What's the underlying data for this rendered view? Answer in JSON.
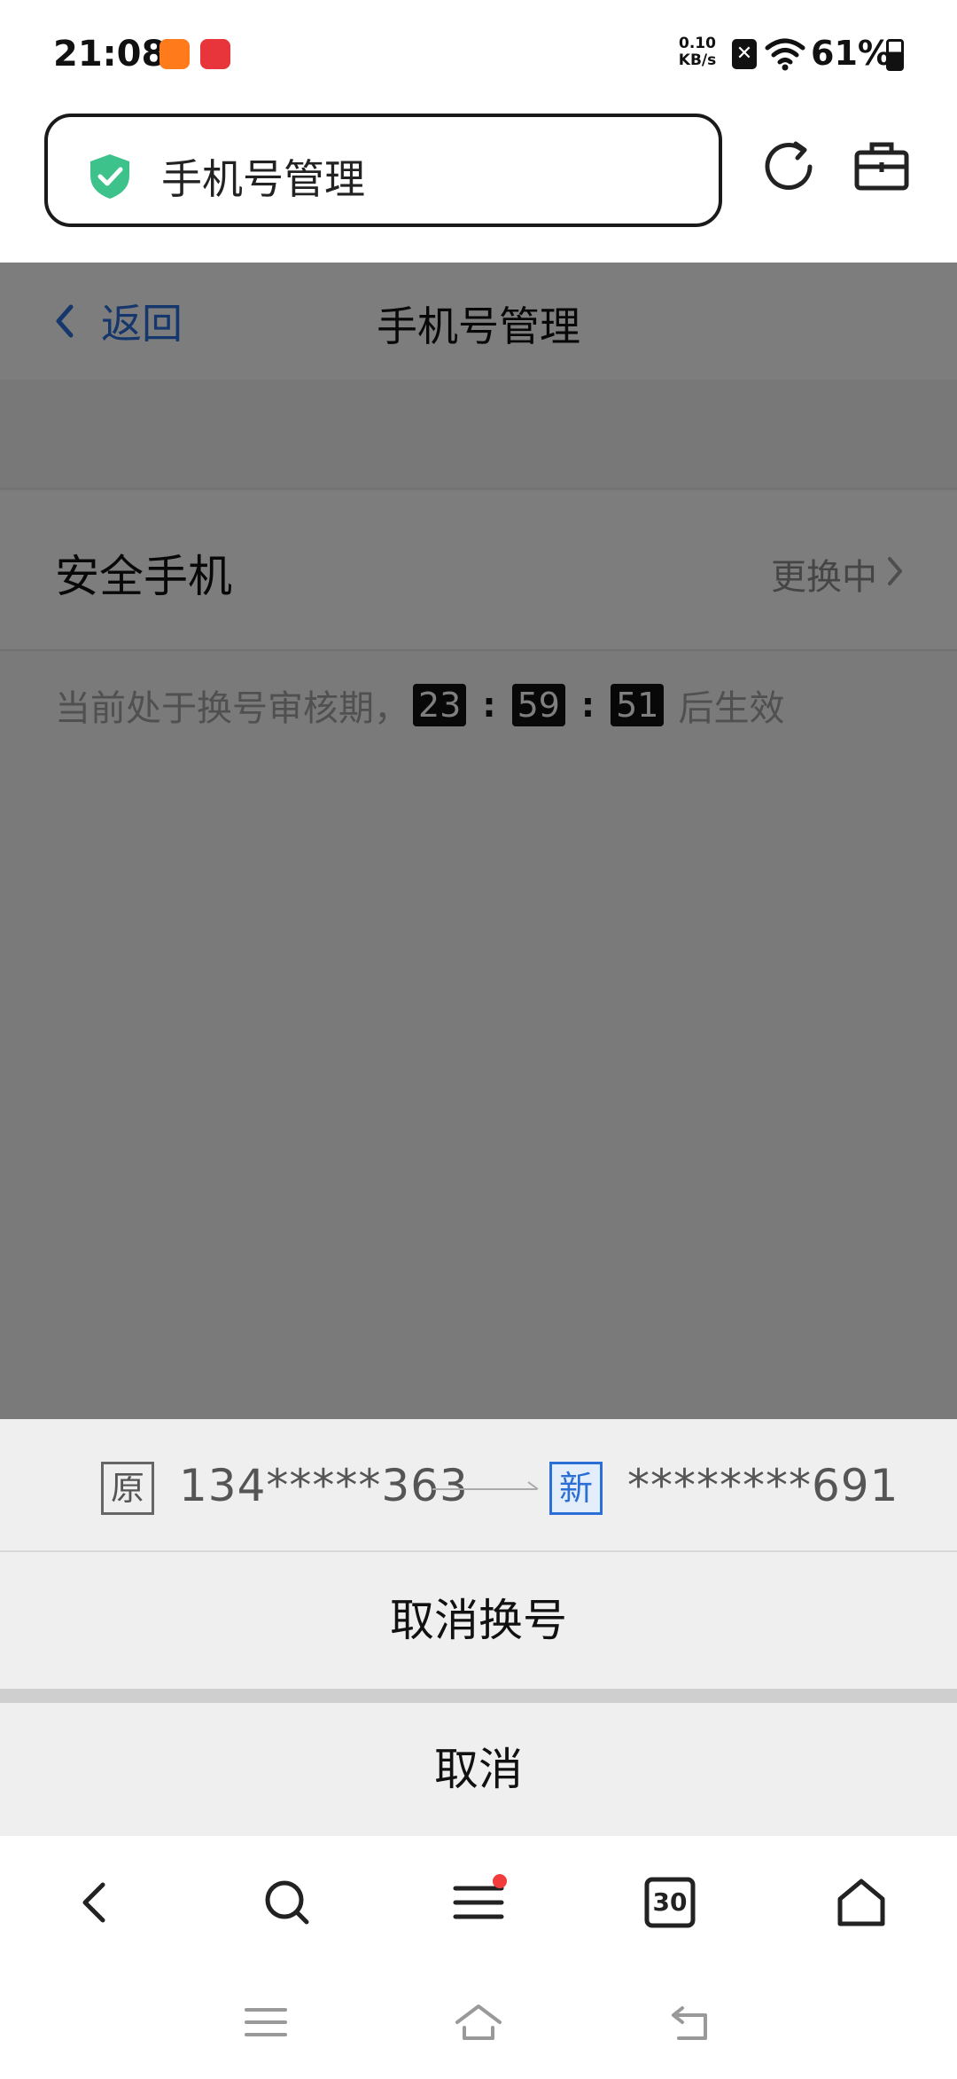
{
  "status_bar": {
    "time": "21:08",
    "net_speed_value": "0.10",
    "net_speed_unit": "KB/s",
    "sim_status": "✕",
    "battery_percent": "61%",
    "icons": [
      "kuaishou-app-icon",
      "huawei-mall-app-icon",
      "sim-icon",
      "wifi-icon",
      "battery-icon"
    ]
  },
  "browser": {
    "url_title": "手机号管理",
    "icons": [
      "security-shield-icon",
      "refresh-icon",
      "toolbox-icon"
    ]
  },
  "page": {
    "back_label": "返回",
    "title": "手机号管理",
    "security_phone_label": "安全手机",
    "security_phone_status": "更换中",
    "review_text_prefix": "当前处于换号审核期，",
    "countdown": {
      "hours": "23",
      "separator": ":",
      "minutes": "59",
      "seconds": "51"
    },
    "review_text_suffix": "后生效"
  },
  "action_sheet": {
    "old_tag": "原",
    "old_number": "134*****363",
    "new_tag": "新",
    "new_number": "********691",
    "cancel_change_label": "取消换号",
    "cancel_label": "取消"
  },
  "bottom_nav": {
    "tabs_count": "30",
    "icons": [
      "back-icon",
      "search-icon",
      "menu-icon",
      "tabs-icon",
      "home-icon"
    ]
  },
  "colors": {
    "accent_blue": "#2a6fd6",
    "shield_green": "#3cc28a",
    "notification_red": "#f23c3c"
  }
}
